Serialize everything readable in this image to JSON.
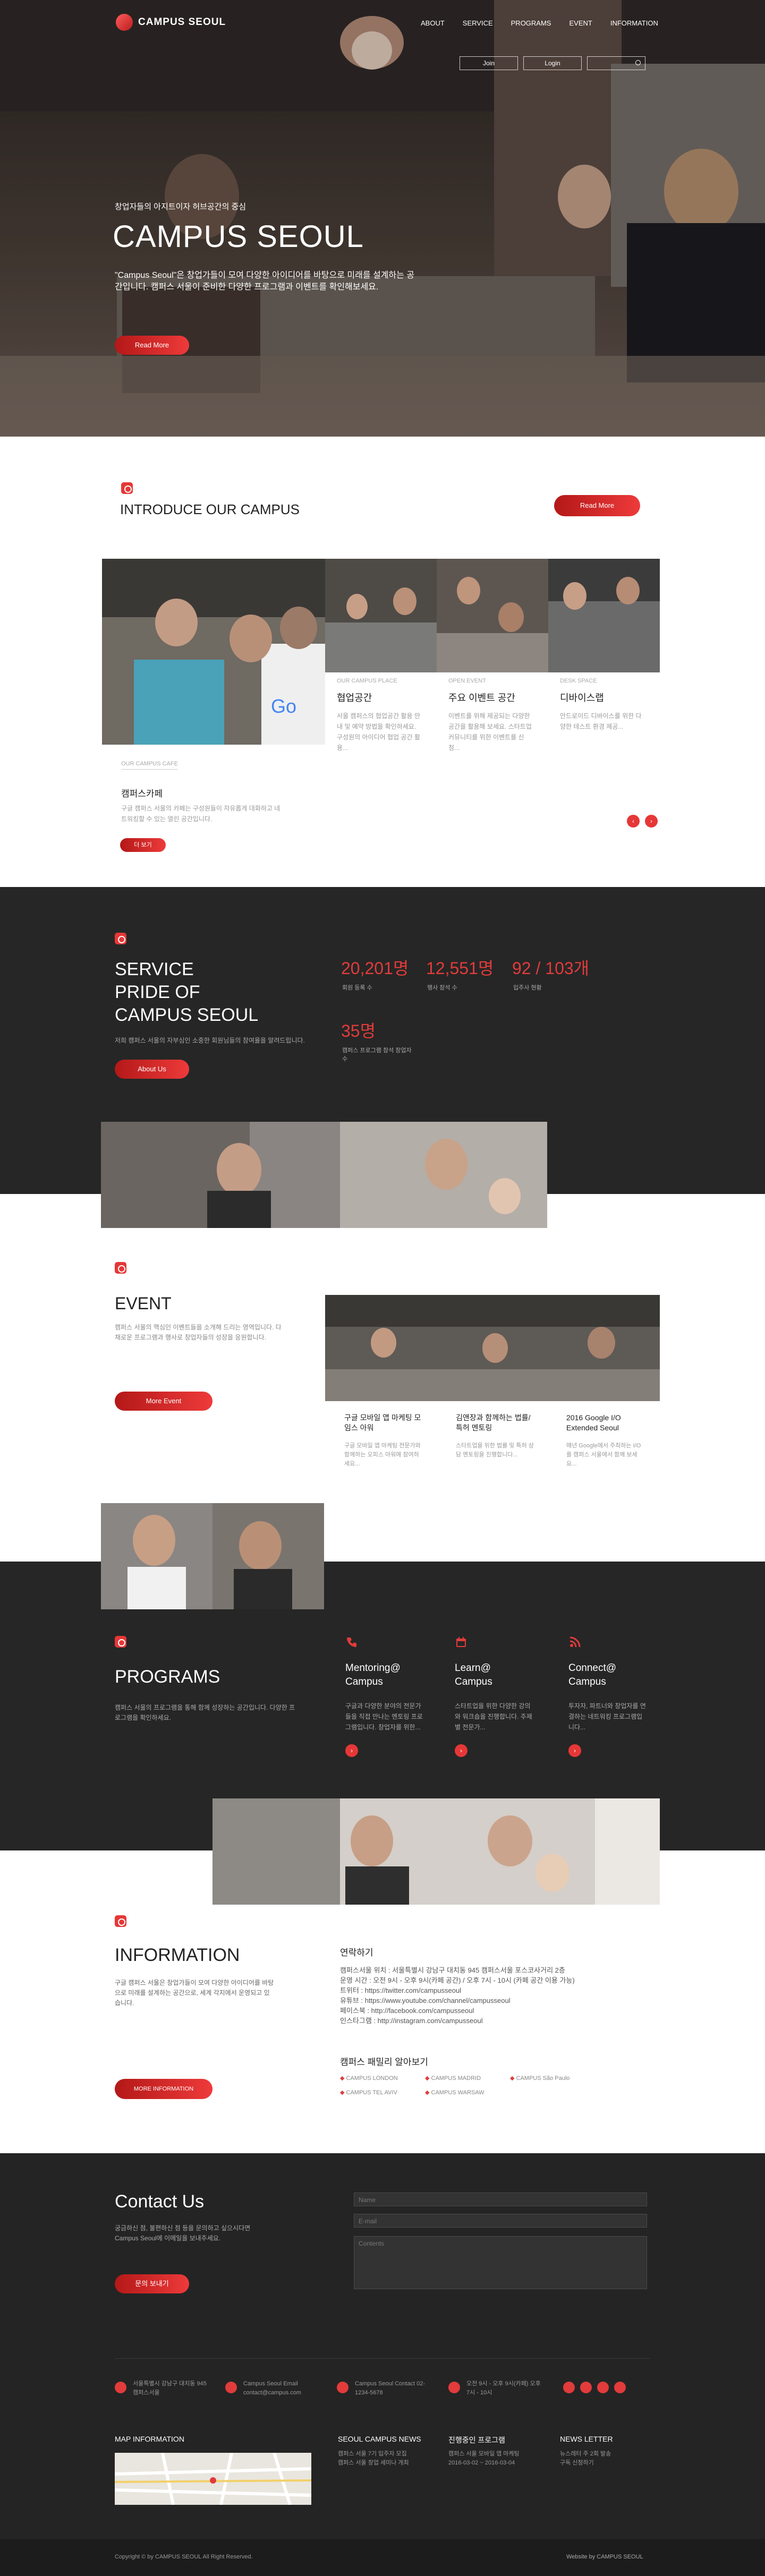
{
  "nav": {
    "logo": "CAMPUS SEOUL",
    "menu": [
      "ABOUT",
      "SERVICE",
      "PROGRAMS",
      "EVENT",
      "INFORMATION"
    ],
    "join": "Join",
    "login": "Login"
  },
  "hero": {
    "subtitle": "창업자들의 아지트이자 허브공간의 중심",
    "title": "CAMPUS SEOUL",
    "desc": "\"Campus Seoul\"은 창업가들이 모여 다양한 아이디어를 바탕으로 미래를 설계하는 공간입니다. 캠퍼스 서울이 준비한 다양한 프로그램과 이벤트를 확인해보세요.",
    "button": "Read More"
  },
  "introduce": {
    "title": "INTRODUCE OUR CAMPUS",
    "button": "Read More",
    "main_card": {
      "category": "OUR CAMPUS CAFE",
      "title": "캠퍼스카페",
      "text": "구글 캠퍼스 서울의 카페는 구성원들이 자유롭게 대화하고 네트워킹할 수 있는 열린 공간입니다.",
      "button": "더 보기"
    },
    "cards": [
      {
        "category": "OUR CAMPUS PLACE",
        "title": "협업공간",
        "text": "서울 캠퍼스의 협업공간 활용 안내 및 예약 방법을 확인하세요. 구성원의 아이디어 협업 공간 활용..."
      },
      {
        "category": "OPEN EVENT",
        "title": "주요 이벤트 공간",
        "text": "이벤트를 위해 제공되는 다양한 공간을 활용해 보세요. 스타트업 커뮤니티를 위한 이벤트를 신청..."
      },
      {
        "category": "DESK SPACE",
        "title": "디바이스랩",
        "text": "안드로이드 디바이스를 위한 다양한 테스트 환경 제공..."
      }
    ]
  },
  "service": {
    "title_lines": [
      "SERVICE",
      "PRIDE OF",
      "CAMPUS SEOUL"
    ],
    "desc": "저희 캠퍼스 서울의 자부심인 소중한 회원님들의 참여율을 알려드립니다.",
    "button": "About Us",
    "stats": [
      {
        "value": "20,201명",
        "label": "회원 등록 수"
      },
      {
        "value": "12,551명",
        "label": "행사 참석 수"
      },
      {
        "value": "92 / 103개",
        "label": "입주사 현황"
      },
      {
        "value": "35명",
        "label": "캠퍼스 프로그램 참석 창업자 수"
      }
    ]
  },
  "event": {
    "title": "EVENT",
    "desc": "캠퍼스 서울의 핵심인 이벤트들을 소개해 드리는 영역입니다. 다채로운 프로그램과 행사로 창업자들의 성장을 응원합니다.",
    "button": "More Event",
    "cards": [
      {
        "title": "구글 모바일 앱 마케팅 모임스 아워",
        "text": "구글 모바일 앱 마케팅 전문가와 함께하는 오피스 아워에 참여하세요..."
      },
      {
        "title": "김앤장과 함께하는 법률/특허 멘토링",
        "text": "스타트업을 위한 법률 및 특허 상담 멘토링을 진행합니다..."
      },
      {
        "title": "2016 Google I/O Extended Seoul",
        "text": "매년 Google에서 주최하는 I/O를 캠퍼스 서울에서 함께 보세요..."
      }
    ]
  },
  "programs": {
    "title": "PROGRAMS",
    "desc": "캠퍼스 서울의 프로그램을 통해 함께 성장하는 공간입니다. 다양한 프로그램을 확인하세요.",
    "items": [
      {
        "title": "Mentoring@ Campus",
        "text": "구글과 다양한 분야의 전문가들을 직접 만나는 멘토링 프로그램입니다. 창업자를 위한...",
        "icon": "phone-icon"
      },
      {
        "title": "Learn@ Campus",
        "text": "스타트업을 위한 다양한 강의와 워크숍을 진행합니다. 주제별 전문가...",
        "icon": "calendar-icon"
      },
      {
        "title": "Connect@ Campus",
        "text": "투자자, 파트너와 창업자를 연결하는 네트워킹 프로그램입니다...",
        "icon": "rss-icon"
      }
    ]
  },
  "information": {
    "title": "INFORMATION",
    "desc": "구글 캠퍼스 서울은 창업가들이 모여 다양한 아이디어를 바탕으로 미래를 설계하는 공간으로, 세계 각지에서 운영되고 있습니다.",
    "button": "MORE INFORMATION",
    "contact_title": "연락하기",
    "contact_lines": [
      "캠퍼스서울 위치 : 서울특별시 강남구 대치동 945 캠퍼스서울 포스코사거리 2층",
      "운영 시간 : 오전 9시 - 오후 9시(카페 공간) / 오후 7시 - 10시 (카페 공간 이용 가능)",
      "트위터 : https://twitter.com/campusseoul",
      "유튜브 : https://www.youtube.com/channel/campusseoul",
      "페이스북 : http://facebook.com/campusseoul",
      "인스타그램 : http://instagram.com/campusseoul"
    ],
    "family_title": "캠퍼스 패밀리 알아보기",
    "family": [
      "CAMPUS LONDON",
      "CAMPUS MADRID",
      "CAMPUS São Paulo",
      "CAMPUS TEL AVIV",
      "CAMPUS WARSAW"
    ]
  },
  "contact": {
    "title": "Contact Us",
    "desc": "궁금하신 점, 불편하신 점 등을 문의하고 싶으시다면 Campus Seoul에 이메일을 보내주세요.",
    "button": "문의 보내기",
    "name_placeholder": "Name",
    "email_placeholder": "E-mail",
    "content_placeholder": "Contents"
  },
  "footer": {
    "info": [
      {
        "text": "서울특별시 강남구 대치동 945 캠퍼스서울",
        "icon": "map-pin-icon"
      },
      {
        "text": "Campus Seoul Email contact@campus.com",
        "icon": "mail-icon"
      },
      {
        "text": "Campus Seoul Contact 02-1234-5678",
        "icon": "phone-icon"
      },
      {
        "text": "오전 9시 - 오후 9시(카페) 오후 7시 - 10시",
        "icon": "clock-icon"
      }
    ],
    "map_title": "MAP INFORMATION",
    "news_title": "SEOUL CAMPUS NEWS",
    "news": [
      "캠퍼스 서울 7기 입주자 모집",
      "캠퍼스 서울 창업 세미나 개최"
    ],
    "program_title": "진행중인 프로그램",
    "program": [
      "캠퍼스 서울 모바일 앱 마케팅",
      "2016-03-02 ~ 2016-03-04"
    ],
    "letter_title": "NEWS LETTER",
    "letter": [
      "뉴스레터 주 2회 발송",
      "구독 신청하기"
    ],
    "copyright": "Copyright © by CAMPUS SEOUL All Right Reserved.",
    "credit": "Website by CAMPUS SEOUL"
  }
}
